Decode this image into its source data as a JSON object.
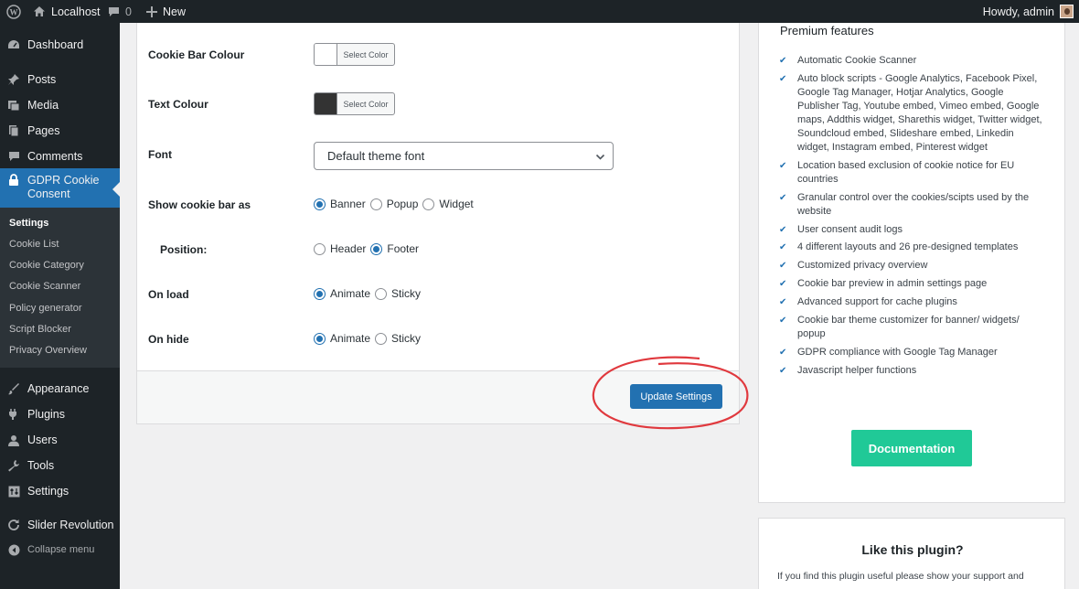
{
  "admin_bar": {
    "site_name": "Localhost",
    "comments_count": "0",
    "new_label": "New",
    "greeting": "Howdy, admin"
  },
  "sidebar": {
    "items": [
      {
        "label": "Dashboard",
        "icon": "dashboard-icon"
      },
      {
        "label": "Posts",
        "icon": "pin-icon"
      },
      {
        "label": "Media",
        "icon": "media-icon"
      },
      {
        "label": "Pages",
        "icon": "pages-icon"
      },
      {
        "label": "Comments",
        "icon": "comment-icon"
      },
      {
        "label": "GDPR Cookie Consent",
        "icon": "lock-icon"
      },
      {
        "label": "Appearance",
        "icon": "paintbrush-icon"
      },
      {
        "label": "Plugins",
        "icon": "plug-icon"
      },
      {
        "label": "Users",
        "icon": "user-icon"
      },
      {
        "label": "Tools",
        "icon": "wrench-icon"
      },
      {
        "label": "Settings",
        "icon": "sliders-icon"
      },
      {
        "label": "Slider Revolution",
        "icon": "refresh-icon"
      }
    ],
    "gdpr_label_line1": "GDPR Cookie",
    "gdpr_label_line2": "Consent",
    "submenu": [
      "Settings",
      "Cookie List",
      "Cookie Category",
      "Cookie Scanner",
      "Policy generator",
      "Script Blocker",
      "Privacy Overview"
    ],
    "collapse_label": "Collapse menu"
  },
  "settings": {
    "cookie_bar_colour_label": "Cookie Bar Colour",
    "text_colour_label": "Text Colour",
    "select_color_label": "Select Color",
    "cookie_bar_color": "#ffffff",
    "text_color": "#333333",
    "font_label": "Font",
    "font_value": "Default theme font",
    "show_as_label": "Show cookie bar as",
    "show_as_options": [
      "Banner",
      "Popup",
      "Widget"
    ],
    "show_as_selected": "Banner",
    "position_label": "Position:",
    "position_options": [
      "Header",
      "Footer"
    ],
    "position_selected": "Footer",
    "on_load_label": "On load",
    "on_load_options": [
      "Animate",
      "Sticky"
    ],
    "on_load_selected": "Animate",
    "on_hide_label": "On hide",
    "on_hide_options": [
      "Animate",
      "Sticky"
    ],
    "on_hide_selected": "Animate",
    "update_button": "Update Settings"
  },
  "premium": {
    "title": "Premium features",
    "features": [
      "Automatic Cookie Scanner",
      "Auto block scripts - Google Analytics, Facebook Pixel, Google Tag Manager, Hotjar Analytics, Google Publisher Tag, Youtube embed, Vimeo embed, Google maps, Addthis widget, Sharethis widget, Twitter widget, Soundcloud embed, Slideshare embed, Linkedin widget, Instagram embed, Pinterest widget",
      "Location based exclusion of cookie notice for EU countries",
      "Granular control over the cookies/scipts used by the website",
      "User consent audit logs",
      "4 different layouts and 26 pre-designed templates",
      "Customized privacy overview",
      "Cookie bar preview in admin settings page",
      "Advanced support for cache plugins",
      "Cookie bar theme customizer for banner/ widgets/ popup",
      "GDPR compliance with Google Tag Manager",
      "Javascript helper functions"
    ],
    "documentation_button": "Documentation"
  },
  "like_plugin": {
    "title": "Like this plugin?",
    "text": "If you find this plugin useful please show your support and"
  },
  "colors": {
    "admin_bg": "#1d2327",
    "accent": "#2271b1",
    "doc_button": "#20c997",
    "highlight_circle": "#e0393e"
  }
}
